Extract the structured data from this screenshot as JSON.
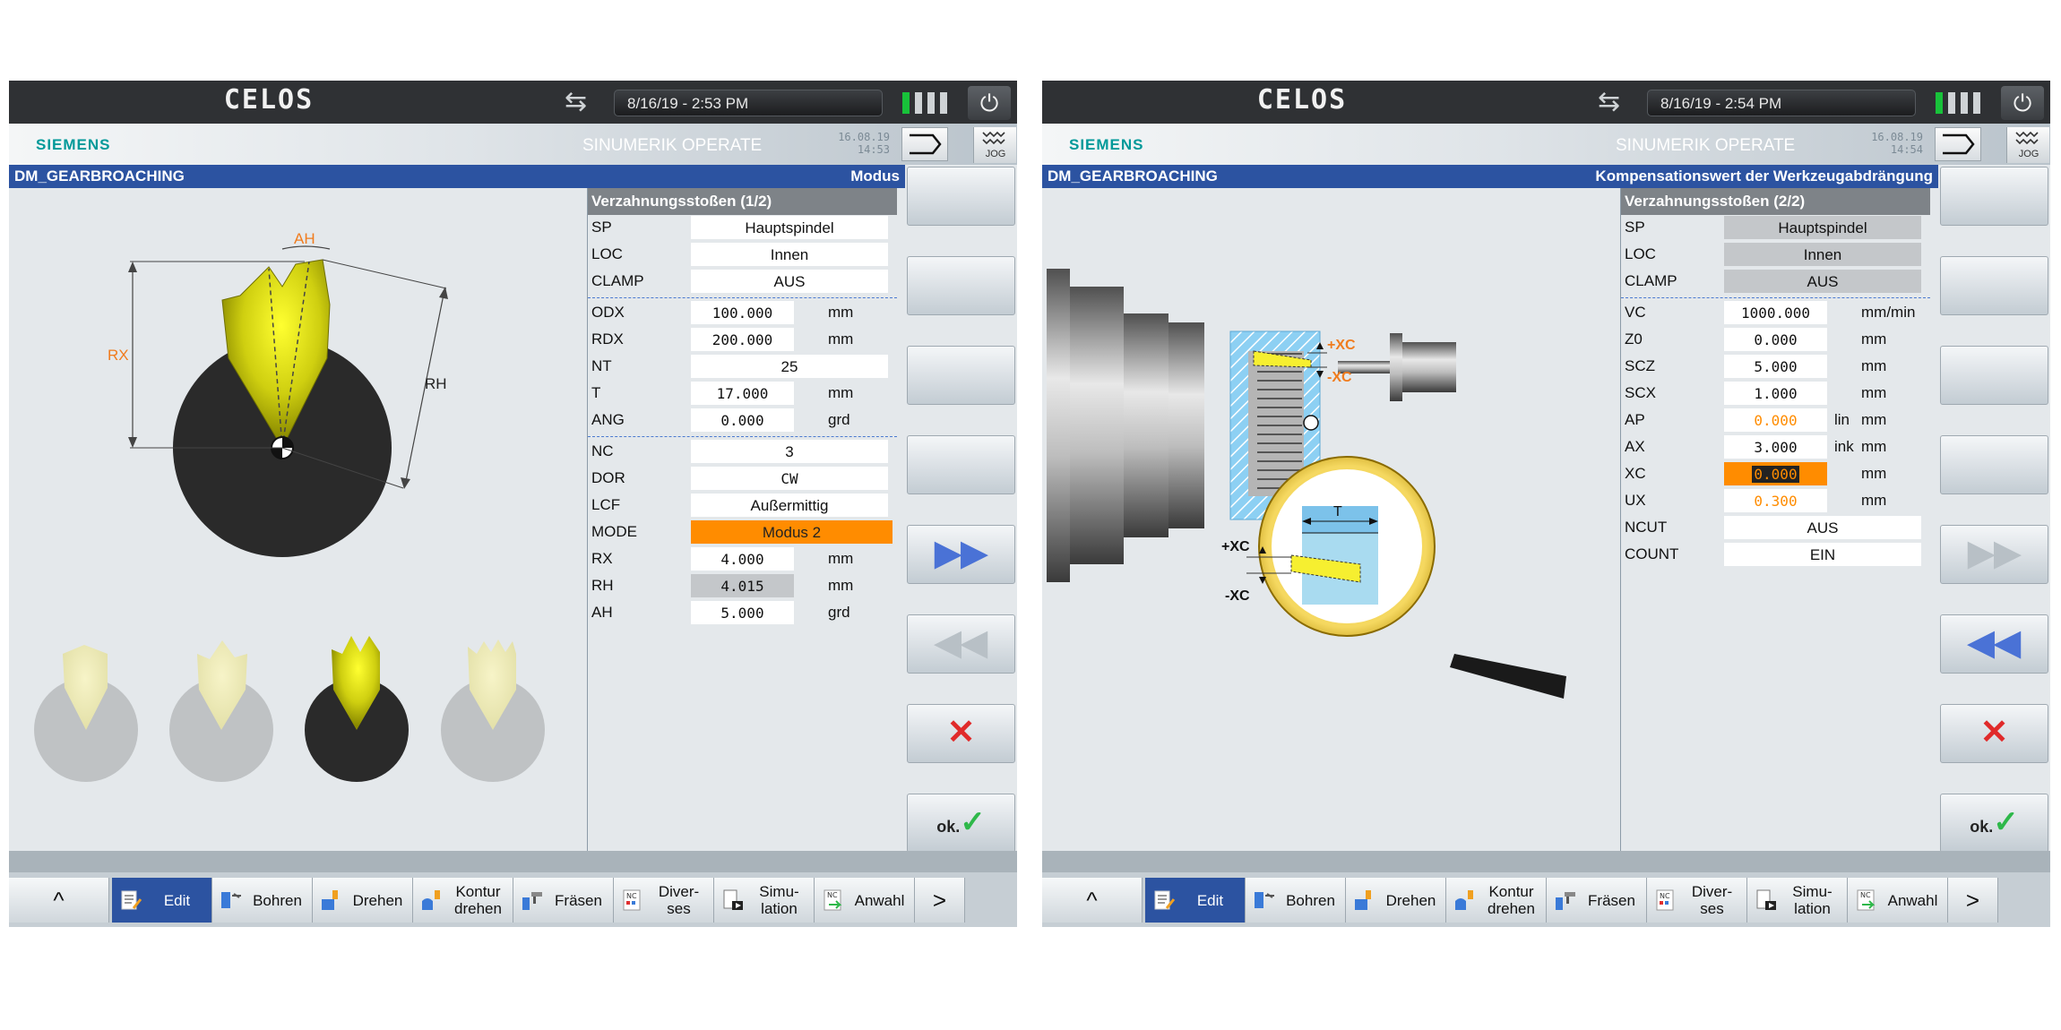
{
  "panels": [
    {
      "celos": "CELOS",
      "datetime": "8/16/19 - 2:53 PM",
      "brand": "SIEMENS",
      "product": "SINUMERIK OPERATE",
      "hdr_date": "16.08.19",
      "hdr_time": "14:53",
      "mode": "JOG",
      "cycle": "DM_GEARBROACHING",
      "hint": "Modus",
      "form_title": "Verzahnungsstoßen (1/2)",
      "rows": [
        {
          "label": "SP",
          "value": "Hauptspindel",
          "unit": ""
        },
        {
          "label": "LOC",
          "value": "Innen",
          "unit": ""
        },
        {
          "label": "CLAMP",
          "value": "AUS",
          "unit": ""
        },
        {
          "label": "ODX",
          "value": "100.000",
          "unit": "mm"
        },
        {
          "label": "RDX",
          "value": "200.000",
          "unit": "mm"
        },
        {
          "label": "NT",
          "value": "25",
          "unit": ""
        },
        {
          "label": "T",
          "value": "17.000",
          "unit": "mm"
        },
        {
          "label": "ANG",
          "value": "0.000",
          "unit": "grd"
        },
        {
          "label": "NC",
          "value": "3",
          "unit": ""
        },
        {
          "label": "DOR",
          "value": "CW",
          "unit": ""
        },
        {
          "label": "LCF",
          "value": "Außermittig",
          "unit": ""
        },
        {
          "label": "MODE",
          "value": "Modus 2",
          "unit": ""
        },
        {
          "label": "RX",
          "value": "4.000",
          "unit": "mm"
        },
        {
          "label": "RH",
          "value": "4.015",
          "unit": "mm"
        },
        {
          "label": "AH",
          "value": "5.000",
          "unit": "grd"
        }
      ],
      "diagram_labels": {
        "ah": "AH",
        "rx": "RX",
        "rh": "RH"
      }
    },
    {
      "celos": "CELOS",
      "datetime": "8/16/19 - 2:54 PM",
      "brand": "SIEMENS",
      "product": "SINUMERIK OPERATE",
      "hdr_date": "16.08.19",
      "hdr_time": "14:54",
      "mode": "JOG",
      "cycle": "DM_GEARBROACHING",
      "hint": "Kompensationswert der Werkzeugabdrängung",
      "form_title": "Verzahnungsstoßen (2/2)",
      "rows": [
        {
          "label": "SP",
          "value": "Hauptspindel",
          "unit": ""
        },
        {
          "label": "LOC",
          "value": "Innen",
          "unit": ""
        },
        {
          "label": "CLAMP",
          "value": "AUS",
          "unit": ""
        },
        {
          "label": "VC",
          "value": "1000.000",
          "unit": "mm/min"
        },
        {
          "label": "Z0",
          "value": "0.000",
          "unit": "mm"
        },
        {
          "label": "SCZ",
          "value": "5.000",
          "unit": "mm"
        },
        {
          "label": "SCX",
          "value": "1.000",
          "unit": "mm"
        },
        {
          "label": "AP",
          "value": "0.000",
          "ink": "lin",
          "unit": "mm"
        },
        {
          "label": "AX",
          "value": "3.000",
          "ink": "ink",
          "unit": "mm"
        },
        {
          "label": "XC",
          "value": "0.000",
          "unit": "mm"
        },
        {
          "label": "UX",
          "value": "0.300",
          "unit": "mm"
        },
        {
          "label": "NCUT",
          "value": "AUS",
          "unit": ""
        },
        {
          "label": "COUNT",
          "value": "EIN",
          "unit": ""
        }
      ],
      "diagram_labels": {
        "pxc1": "+XC",
        "mxc1": "-XC",
        "t": "T",
        "pxc2": "+XC",
        "mxc2": "-XC"
      }
    }
  ],
  "hbar": {
    "up": "^",
    "edit": "Edit",
    "bohren": "Bohren",
    "drehen": "Drehen",
    "kontur1": "Kontur",
    "kontur2": "drehen",
    "fraesen": "Fräsen",
    "div1": "Diver-",
    "div2": "ses",
    "sim1": "Simu-",
    "sim2": "lation",
    "anwahl": "Anwahl",
    "next": ">",
    "nc": "NC"
  },
  "softkeys": {
    "ok": "ok."
  },
  "colors": {
    "orange": "#ff8c00",
    "blue": "#2c53a1",
    "teal": "#009999",
    "green": "#18c23a",
    "yellow": "#ffff00"
  }
}
